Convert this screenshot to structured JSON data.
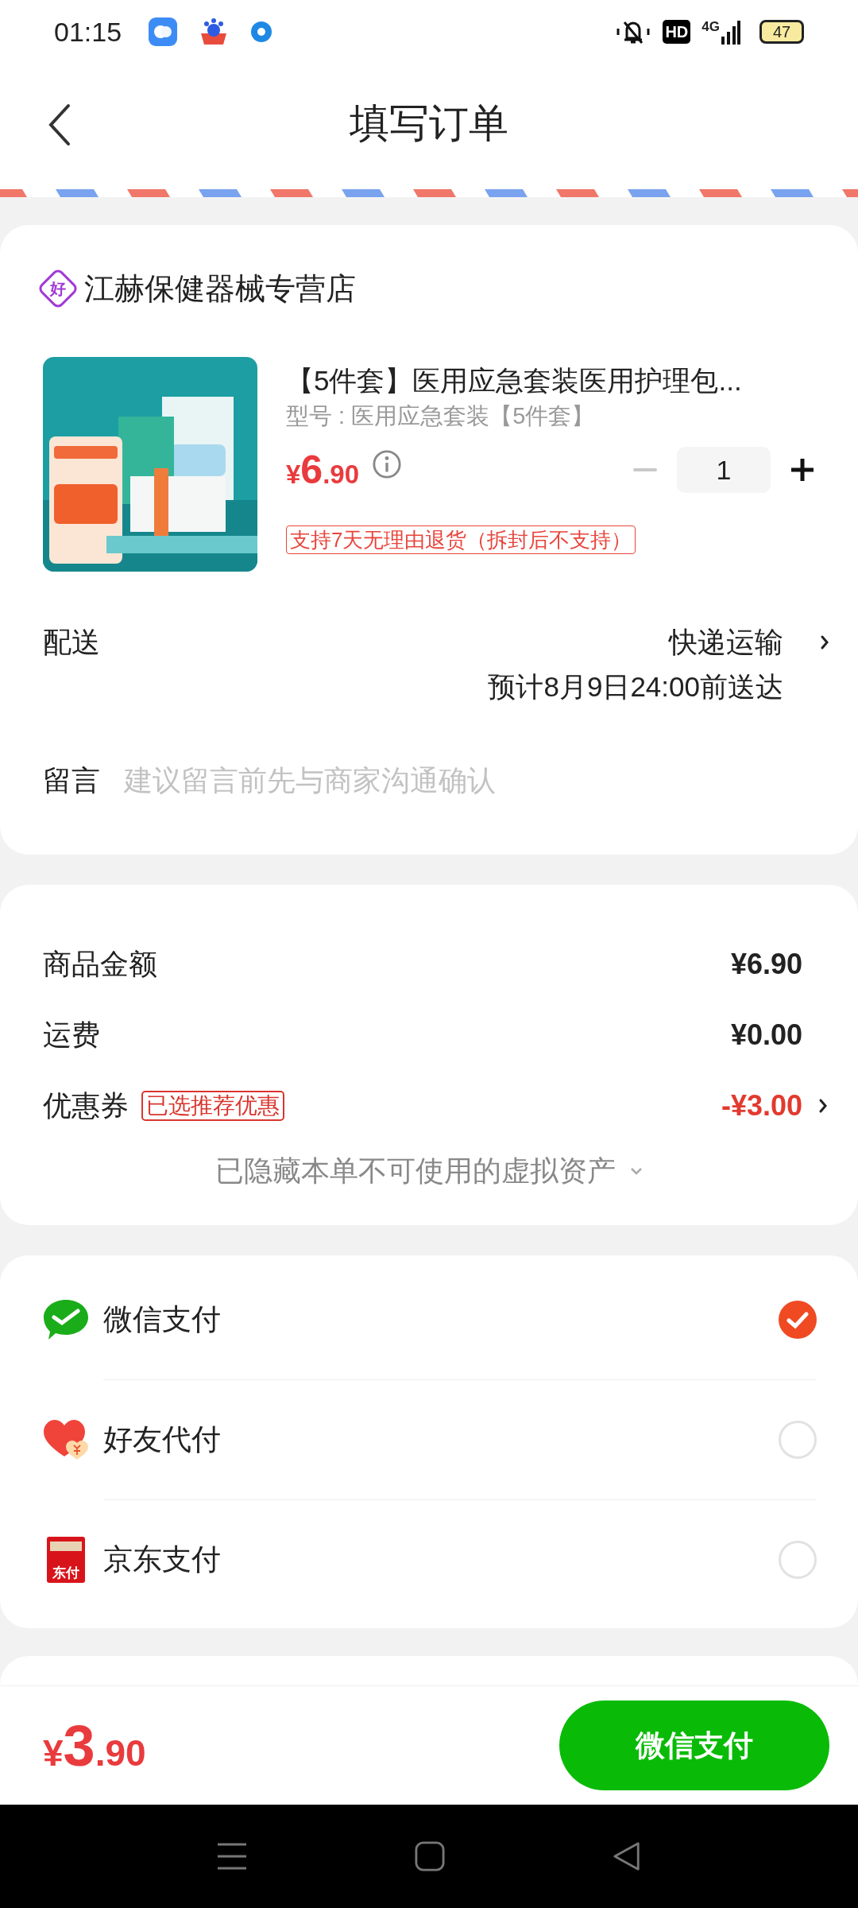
{
  "status_bar": {
    "time": "01:15",
    "hd": "HD",
    "network": "4G",
    "battery": "47"
  },
  "header": {
    "title": "填写订单"
  },
  "store": {
    "badge": "好",
    "name": "江赫保健器械专营店"
  },
  "product": {
    "title": "【5件套】医用应急套装医用护理包...",
    "spec": "型号 : 医用应急套装【5件套】",
    "price": {
      "currency": "¥",
      "integer": "6",
      "decimal": ".90"
    },
    "quantity": {
      "value": "1",
      "minus_disabled": true
    },
    "return_tag": "支持7天无理由退货（拆封后不支持）"
  },
  "delivery": {
    "label": "配送",
    "method": "快递运输",
    "estimate": "预计8月9日24:00前送达"
  },
  "message": {
    "label": "留言",
    "placeholder": "建议留言前先与商家沟通确认"
  },
  "summary": {
    "rows": [
      {
        "kind": "plain",
        "label": "商品金额",
        "value": "¥6.90"
      },
      {
        "kind": "plain",
        "label": "运费",
        "value": "¥0.00"
      },
      {
        "kind": "coupon",
        "label": "优惠券",
        "tag": "已选推荐优惠",
        "value": "-¥3.00"
      }
    ],
    "hidden_note": "已隐藏本单不可使用的虚拟资产"
  },
  "payment_methods": [
    {
      "kind": "wechat",
      "label": "微信支付",
      "selected": true
    },
    {
      "kind": "friend",
      "label": "好友代付",
      "selected": false
    },
    {
      "kind": "jd",
      "label": "京东支付",
      "icon_text": "东付",
      "selected": false
    }
  ],
  "bottom_bar": {
    "total": {
      "currency": "¥",
      "integer": "3",
      "decimal": ".90"
    },
    "pay_button": "微信支付"
  }
}
